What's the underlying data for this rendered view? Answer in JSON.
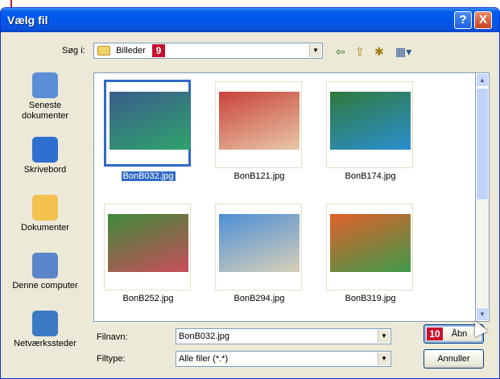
{
  "window": {
    "title": "Vælg fil",
    "help_label": "?",
    "close_label": "X"
  },
  "lookin": {
    "label": "Søg i:",
    "value": "Billeder",
    "badge": "9"
  },
  "toolbar": {
    "icons": [
      "back-icon",
      "up-folder-icon",
      "new-folder-icon",
      "view-menu-icon"
    ]
  },
  "places": [
    {
      "label": "Seneste dokumenter",
      "icon": "recent-documents-icon",
      "color": "#5a8fd6"
    },
    {
      "label": "Skrivebord",
      "icon": "desktop-icon",
      "color": "#2f6fd0"
    },
    {
      "label": "Dokumenter",
      "icon": "my-documents-icon",
      "color": "#f2c14e"
    },
    {
      "label": "Denne computer",
      "icon": "my-computer-icon",
      "color": "#5b86c9"
    },
    {
      "label": "Netværkssteder",
      "icon": "network-places-icon",
      "color": "#3b7bc4"
    }
  ],
  "files": [
    {
      "name": "BonB032.jpg",
      "selected": true,
      "c1": "#3a5d8c",
      "c2": "#2fa36b"
    },
    {
      "name": "BonB121.jpg",
      "selected": false,
      "c1": "#c9423a",
      "c2": "#e8c8a8"
    },
    {
      "name": "BonB174.jpg",
      "selected": false,
      "c1": "#2f7a3d",
      "c2": "#2b8fd0"
    },
    {
      "name": "BonB252.jpg",
      "selected": false,
      "c1": "#3f8a3a",
      "c2": "#c84d5a"
    },
    {
      "name": "BonB294.jpg",
      "selected": false,
      "c1": "#4d8fd6",
      "c2": "#d8d0b8"
    },
    {
      "name": "BonB319.jpg",
      "selected": false,
      "c1": "#e0602a",
      "c2": "#3e9a4a"
    }
  ],
  "filename": {
    "label": "Filnavn:",
    "value": "BonB032.jpg"
  },
  "filetype": {
    "label": "Filtype:",
    "value": "Alle filer (*.*)"
  },
  "buttons": {
    "open": "Åbn",
    "open_badge": "10",
    "cancel": "Annuller"
  },
  "colors": {
    "title_blue": "#0058ee",
    "selection": "#316ac5",
    "badge_red": "#c8102e"
  }
}
